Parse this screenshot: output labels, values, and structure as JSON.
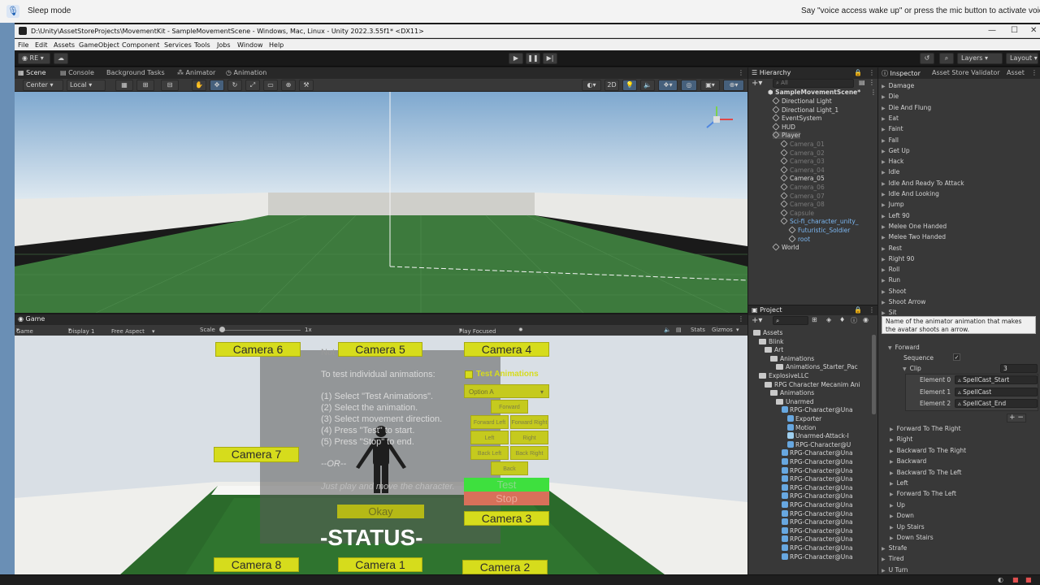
{
  "voice_access": {
    "mode": "Sleep mode",
    "hint": "Say \"voice access wake up\" or press the mic button to activate voice a"
  },
  "window": {
    "title": "D:\\Unity\\AssetStoreProjects\\MovementKit - SampleMovementScene - Windows, Mac, Linux - Unity 2022.3.55f1* <DX11>"
  },
  "menu": [
    "File",
    "Edit",
    "Assets",
    "GameObject",
    "Component",
    "Services",
    "Tools",
    "Jobs",
    "Window",
    "Help"
  ],
  "toolbar": {
    "account": "RE",
    "layers": "Layers",
    "layout": "Layout"
  },
  "scene_tabs": [
    "Scene",
    "Console",
    "Background Tasks",
    "Animator",
    "Animation"
  ],
  "scene_tools": {
    "pivot": "Center",
    "space": "Local",
    "mode_2d": "2D"
  },
  "game_tabs": [
    "Game"
  ],
  "game_bar": {
    "display_mode": "Game",
    "display": "Display 1",
    "aspect": "Free Aspect",
    "scale_label": "Scale",
    "scale_value": "1x",
    "play_focused": "Play Focused",
    "stats": "Stats",
    "gizmos": "Gizmos"
  },
  "game_ui": {
    "cameras": [
      "Camera 6",
      "Camera 5",
      "Camera 4",
      "Camera 7",
      "Camera 3",
      "Camera 8",
      "Camera 1",
      "Camera 2"
    ],
    "panel_title_fragment": "Not",
    "instructions_title": "To test individual animations:",
    "steps": [
      "(1) Select \"Test Animations\".",
      "(2) Select the animation.",
      "(3) Select movement direction.",
      "(4) Press \"Test\" to start.",
      "(5) Press \"Stop\" to end."
    ],
    "or_text": "--OR--",
    "play_text": "Just play and move the character.",
    "test_animations_label": "Test Animations",
    "option_select": "Option A",
    "direction_buttons": [
      "Forward",
      "Forward Left",
      "Forward Right",
      "Left",
      "Right",
      "Back Left",
      "Back Right",
      "Back"
    ],
    "test_label": "Test",
    "stop_label": "Stop",
    "okay_label": "Okay",
    "status": "-STATUS-"
  },
  "hierarchy": {
    "tab": "Hierarchy",
    "search_placeholder": "All",
    "scene": "SampleMovementScene*",
    "items": [
      {
        "label": "Directional Light",
        "indent": 1,
        "dim": false
      },
      {
        "label": "Directional Light_1",
        "indent": 1,
        "dim": false
      },
      {
        "label": "EventSystem",
        "indent": 1,
        "dim": false
      },
      {
        "label": "HUD",
        "indent": 1,
        "dim": false
      },
      {
        "label": "Player",
        "indent": 1,
        "dim": false
      },
      {
        "label": "Camera_01",
        "indent": 2,
        "dim": true
      },
      {
        "label": "Camera_02",
        "indent": 2,
        "dim": true
      },
      {
        "label": "Camera_03",
        "indent": 2,
        "dim": true
      },
      {
        "label": "Camera_04",
        "indent": 2,
        "dim": true
      },
      {
        "label": "Camera_05",
        "indent": 2,
        "dim": false
      },
      {
        "label": "Camera_06",
        "indent": 2,
        "dim": true
      },
      {
        "label": "Camera_07",
        "indent": 2,
        "dim": true
      },
      {
        "label": "Camera_08",
        "indent": 2,
        "dim": true
      },
      {
        "label": "Capsule",
        "indent": 2,
        "dim": true
      },
      {
        "label": "Sci-fi_character_unity_",
        "indent": 2,
        "dim": false,
        "blue": true
      },
      {
        "label": "Futuristic_Soldier",
        "indent": 3,
        "dim": false,
        "blue": true
      },
      {
        "label": "root",
        "indent": 3,
        "dim": false,
        "blue": true
      },
      {
        "label": "World",
        "indent": 1,
        "dim": false
      }
    ]
  },
  "project": {
    "tab": "Project",
    "items": [
      {
        "label": "Assets",
        "indent": 0,
        "type": "folder"
      },
      {
        "label": "Blink",
        "indent": 1,
        "type": "folder"
      },
      {
        "label": "Art",
        "indent": 2,
        "type": "folder"
      },
      {
        "label": "Animations",
        "indent": 3,
        "type": "folder"
      },
      {
        "label": "Animations_Starter_Pac",
        "indent": 4,
        "type": "folder"
      },
      {
        "label": "ExplosiveLLC",
        "indent": 1,
        "type": "folder"
      },
      {
        "label": "RPG Character Mecanim Ani",
        "indent": 2,
        "type": "folder"
      },
      {
        "label": "Animations",
        "indent": 3,
        "type": "folder"
      },
      {
        "label": "Unarmed",
        "indent": 4,
        "type": "folder"
      },
      {
        "label": "RPG-Character@Una",
        "indent": 5,
        "type": "asset"
      },
      {
        "label": "Exporter",
        "indent": 6,
        "type": "asset"
      },
      {
        "label": "Motion",
        "indent": 6,
        "type": "asset"
      },
      {
        "label": "Unarmed-Attack-I",
        "indent": 6,
        "type": "clip"
      },
      {
        "label": "RPG-Character@U",
        "indent": 6,
        "type": "asset"
      },
      {
        "label": "RPG-Character@Una",
        "indent": 5,
        "type": "asset"
      },
      {
        "label": "RPG-Character@Una",
        "indent": 5,
        "type": "asset"
      },
      {
        "label": "RPG-Character@Una",
        "indent": 5,
        "type": "asset"
      },
      {
        "label": "RPG-Character@Una",
        "indent": 5,
        "type": "asset"
      },
      {
        "label": "RPG-Character@Una",
        "indent": 5,
        "type": "asset"
      },
      {
        "label": "RPG-Character@Una",
        "indent": 5,
        "type": "asset"
      },
      {
        "label": "RPG-Character@Una",
        "indent": 5,
        "type": "asset"
      },
      {
        "label": "RPG-Character@Una",
        "indent": 5,
        "type": "asset"
      },
      {
        "label": "RPG-Character@Una",
        "indent": 5,
        "type": "asset"
      },
      {
        "label": "RPG-Character@Una",
        "indent": 5,
        "type": "asset"
      },
      {
        "label": "RPG-Character@Una",
        "indent": 5,
        "type": "asset"
      },
      {
        "label": "RPG-Character@Una",
        "indent": 5,
        "type": "asset"
      },
      {
        "label": "RPG-Character@Una",
        "indent": 5,
        "type": "asset"
      }
    ]
  },
  "inspector": {
    "tabs": [
      "Inspector",
      "Asset Store Validator",
      "Asset"
    ],
    "top_items": [
      "Damage",
      "Die",
      "Die And Flung",
      "Eat",
      "Faint",
      "Fall",
      "Get Up",
      "Hack",
      "Idle",
      "Idle And Ready To Attack",
      "Idle And Looking",
      "Jump",
      "Left 90",
      "Melee One Handed",
      "Melee Two Handed",
      "Rest",
      "Right 90",
      "Roll",
      "Run",
      "Shoot",
      "Shoot Arrow",
      "Sit"
    ],
    "tooltip": "Name of the animator animation that makes the avatar shoots an arrow.",
    "forward_label": "Forward",
    "sequence_label": "Sequence",
    "clip_label": "Clip",
    "clip_count": "3",
    "elements": [
      {
        "label": "Element 0",
        "value": "SpellCast_Start"
      },
      {
        "label": "Element 1",
        "value": "SpellCast"
      },
      {
        "label": "Element 2",
        "value": "SpellCast_End"
      }
    ],
    "direction_items": [
      "Forward To The Right",
      "Right",
      "Backward To The Right",
      "Backward",
      "Backward To The Left",
      "Left",
      "Forward To The Left",
      "Up",
      "Down",
      "Up Stairs",
      "Down Stairs"
    ],
    "bottom_items": [
      "Strafe",
      "Tired",
      "U Turn"
    ]
  }
}
